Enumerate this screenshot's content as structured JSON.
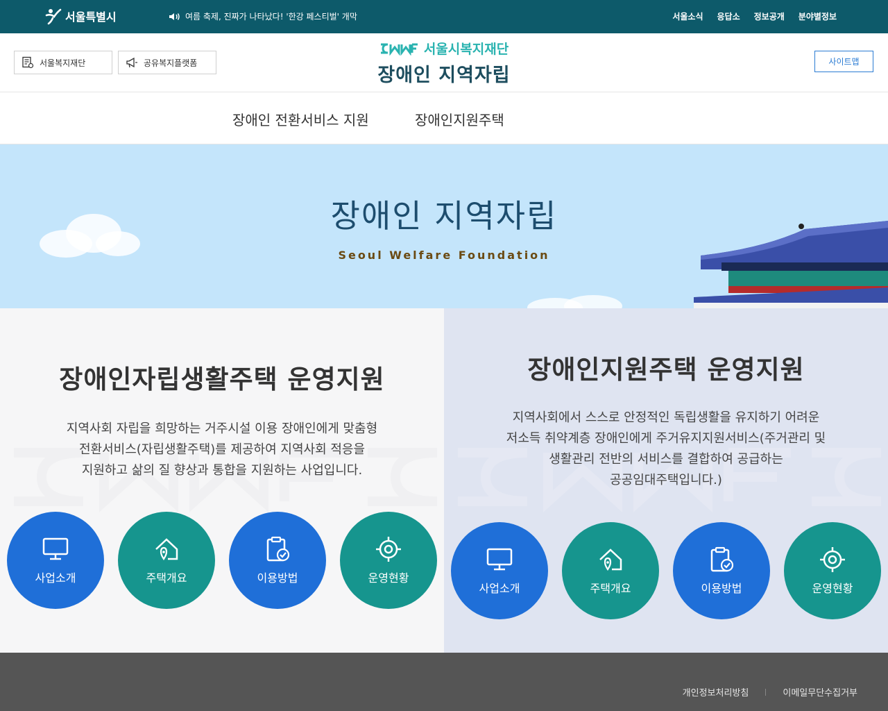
{
  "topbar": {
    "logo_text": "서울특별시",
    "notice": "여름 축제, 진짜가 나타났다! '한강 페스티벌' 개막",
    "util_links": [
      "서울소식",
      "응답소",
      "정보공개",
      "분야별정보"
    ]
  },
  "header": {
    "btn_foundation": "서울복지재단",
    "btn_platform": "공유복지플랫폼",
    "org_name": "서울시복지재단",
    "site_title": "장애인 지역자립",
    "sitemap": "사이트맵"
  },
  "nav": {
    "items": [
      "장애인 전환서비스 지원",
      "장애인지원주택"
    ]
  },
  "hero": {
    "title": "장애인 지역자립",
    "subtitle": "Seoul Welfare Foundation"
  },
  "left_panel": {
    "title": "장애인자립생활주택 운영지원",
    "desc_lines": [
      "지역사회 자립을 희망하는 거주시설 이용 장애인에게 맞춤형",
      "전환서비스(자립생활주택)를 제공하여 지역사회 적응을",
      "지원하고 삶의 질 향상과 통합을 지원하는 사업입니다."
    ],
    "buttons": [
      "사업소개",
      "주택개요",
      "이용방법",
      "운영현황"
    ]
  },
  "right_panel": {
    "title": "장애인지원주택 운영지원",
    "desc_lines": [
      "지역사회에서 스스로 안정적인 독립생활을 유지하기 어려운",
      "저소득 취약계층 장애인에게 주거유지지원서비스(주거관리 및",
      "생활관리 전반의 서비스를 결합하여 공급하는",
      "공공임대주택입니다.)"
    ],
    "buttons": [
      "사업소개",
      "주택개요",
      "이용방법",
      "운영현황"
    ]
  },
  "footer": {
    "links": [
      "개인정보처리방침",
      "이메일무단수집거부"
    ]
  },
  "colors": {
    "topbar": "#0d5a6a",
    "hero_bg": "#c4e5fb",
    "circle_blue": "#1f6fd8",
    "circle_teal": "#16958e",
    "footer": "#555555"
  }
}
